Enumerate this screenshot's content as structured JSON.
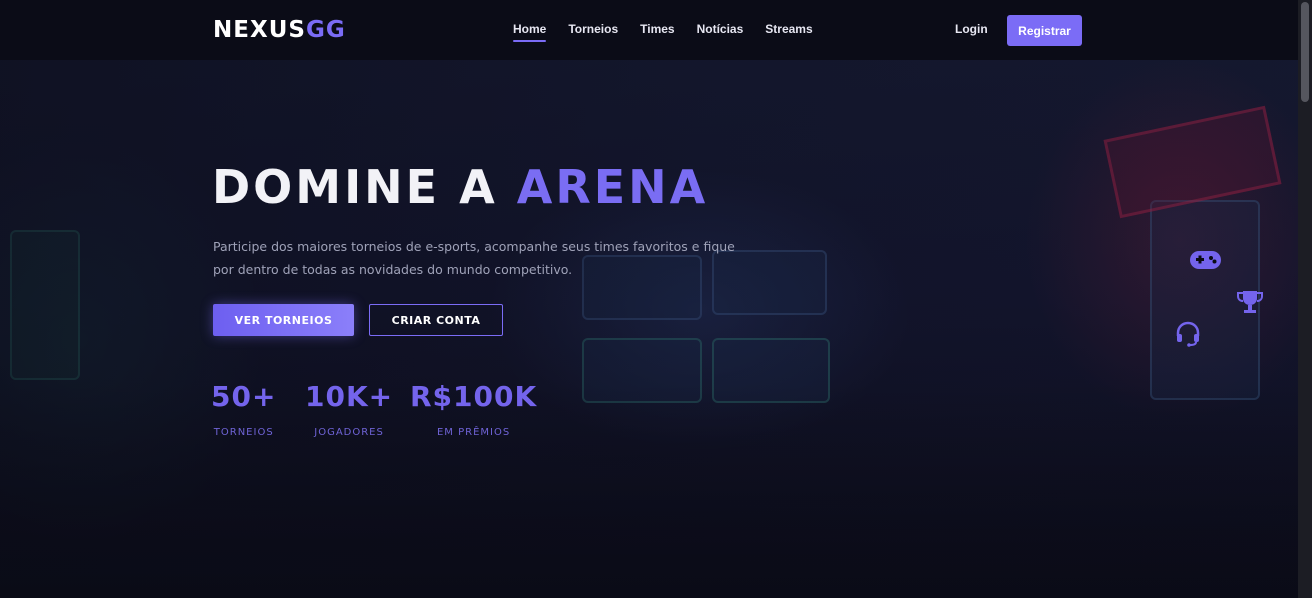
{
  "logo": {
    "part1": "NEXUS",
    "part2": "GG"
  },
  "nav": {
    "links": [
      "Home",
      "Torneios",
      "Times",
      "Notícias",
      "Streams"
    ],
    "active": "Home",
    "login": "Login",
    "register": "Registrar"
  },
  "hero": {
    "title_part1": "DOMINE A",
    "title_part2": "ARENA",
    "description": "Participe dos maiores torneios de e-sports, acompanhe seus times favoritos e fique por dentro de todas as novidades do mundo competitivo.",
    "primary_button": "VER TORNEIOS",
    "secondary_button": "CRIAR CONTA"
  },
  "stats": [
    {
      "value": "50+",
      "label": "TORNEIOS"
    },
    {
      "value": "10K+",
      "label": "JOGADORES"
    },
    {
      "value": "R$100K",
      "label": "EM PRÊMIOS"
    }
  ],
  "floating_icons": [
    "gamepad-icon",
    "trophy-icon",
    "headset-icon"
  ],
  "colors": {
    "accent": "#7b6cf6",
    "background": "#0a0b14",
    "text_muted": "#9fa2b8"
  }
}
